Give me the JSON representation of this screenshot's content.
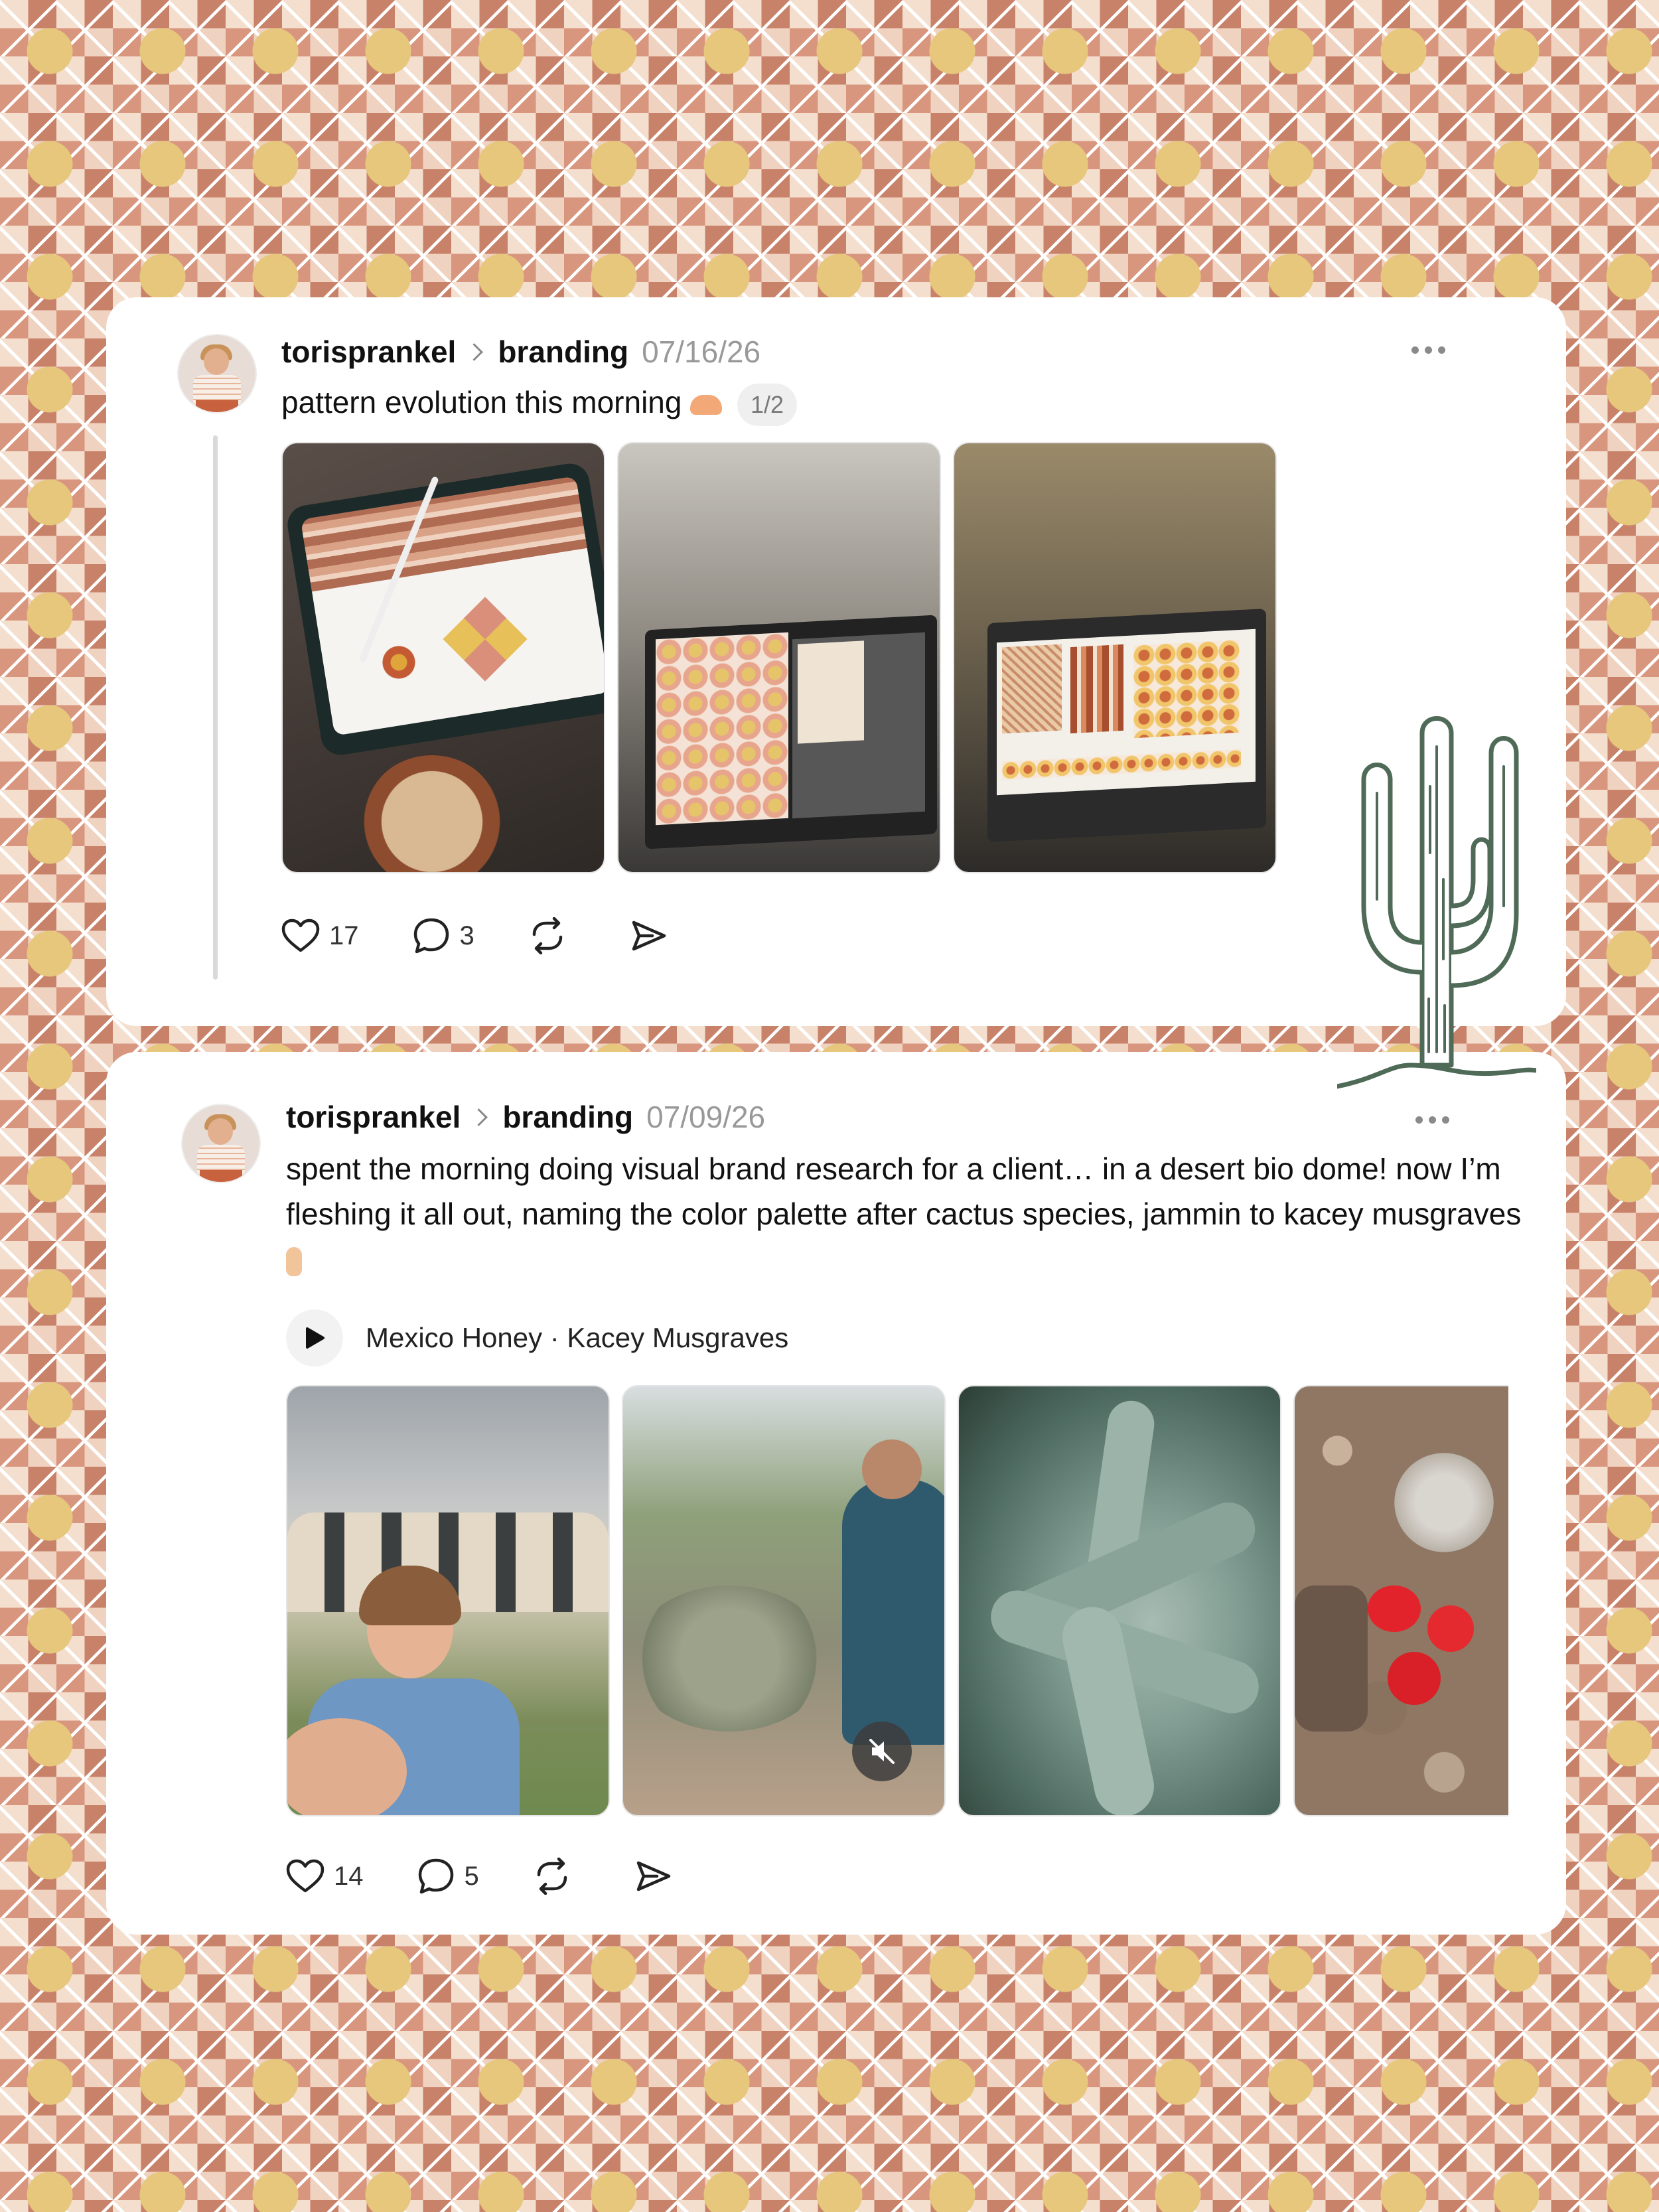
{
  "posts": [
    {
      "username": "torisprankel",
      "topic": "branding",
      "date": "07/16/26",
      "text": "pattern evolution this morning",
      "emoji_icon": "heart-hands-emoji",
      "page_indicator": "1/2",
      "images": [
        "tablet-pattern-sketch-photo",
        "laptop-pattern-layout-photo",
        "laptop-final-patterns-photo"
      ],
      "likes": "17",
      "comments": "3"
    },
    {
      "username": "torisprankel",
      "topic": "branding",
      "date": "07/09/26",
      "text": "spent the morning doing visual brand research for a client… in a desert bio dome! now I’m fleshing it all out, naming the color palette after cactus species, jammin to kacey musgraves",
      "emoji_icon": "peace-sign-emoji",
      "music": "Mexico Honey · Kacey Musgraves",
      "images": [
        "selfie-at-bio-dome-photo",
        "desert-garden-video",
        "agave-plant-photo",
        "red-cactus-flowers-photo"
      ],
      "likes": "14",
      "comments": "5"
    }
  ],
  "icons": [
    "heart-icon",
    "comment-icon",
    "repost-icon",
    "share-icon",
    "more-options-icon",
    "play-icon",
    "muted-icon",
    "cactus-illustration"
  ],
  "colors": {
    "card": "#ffffff",
    "text": "#111111",
    "muted": "#999999",
    "cactus": "#4f6b57"
  }
}
